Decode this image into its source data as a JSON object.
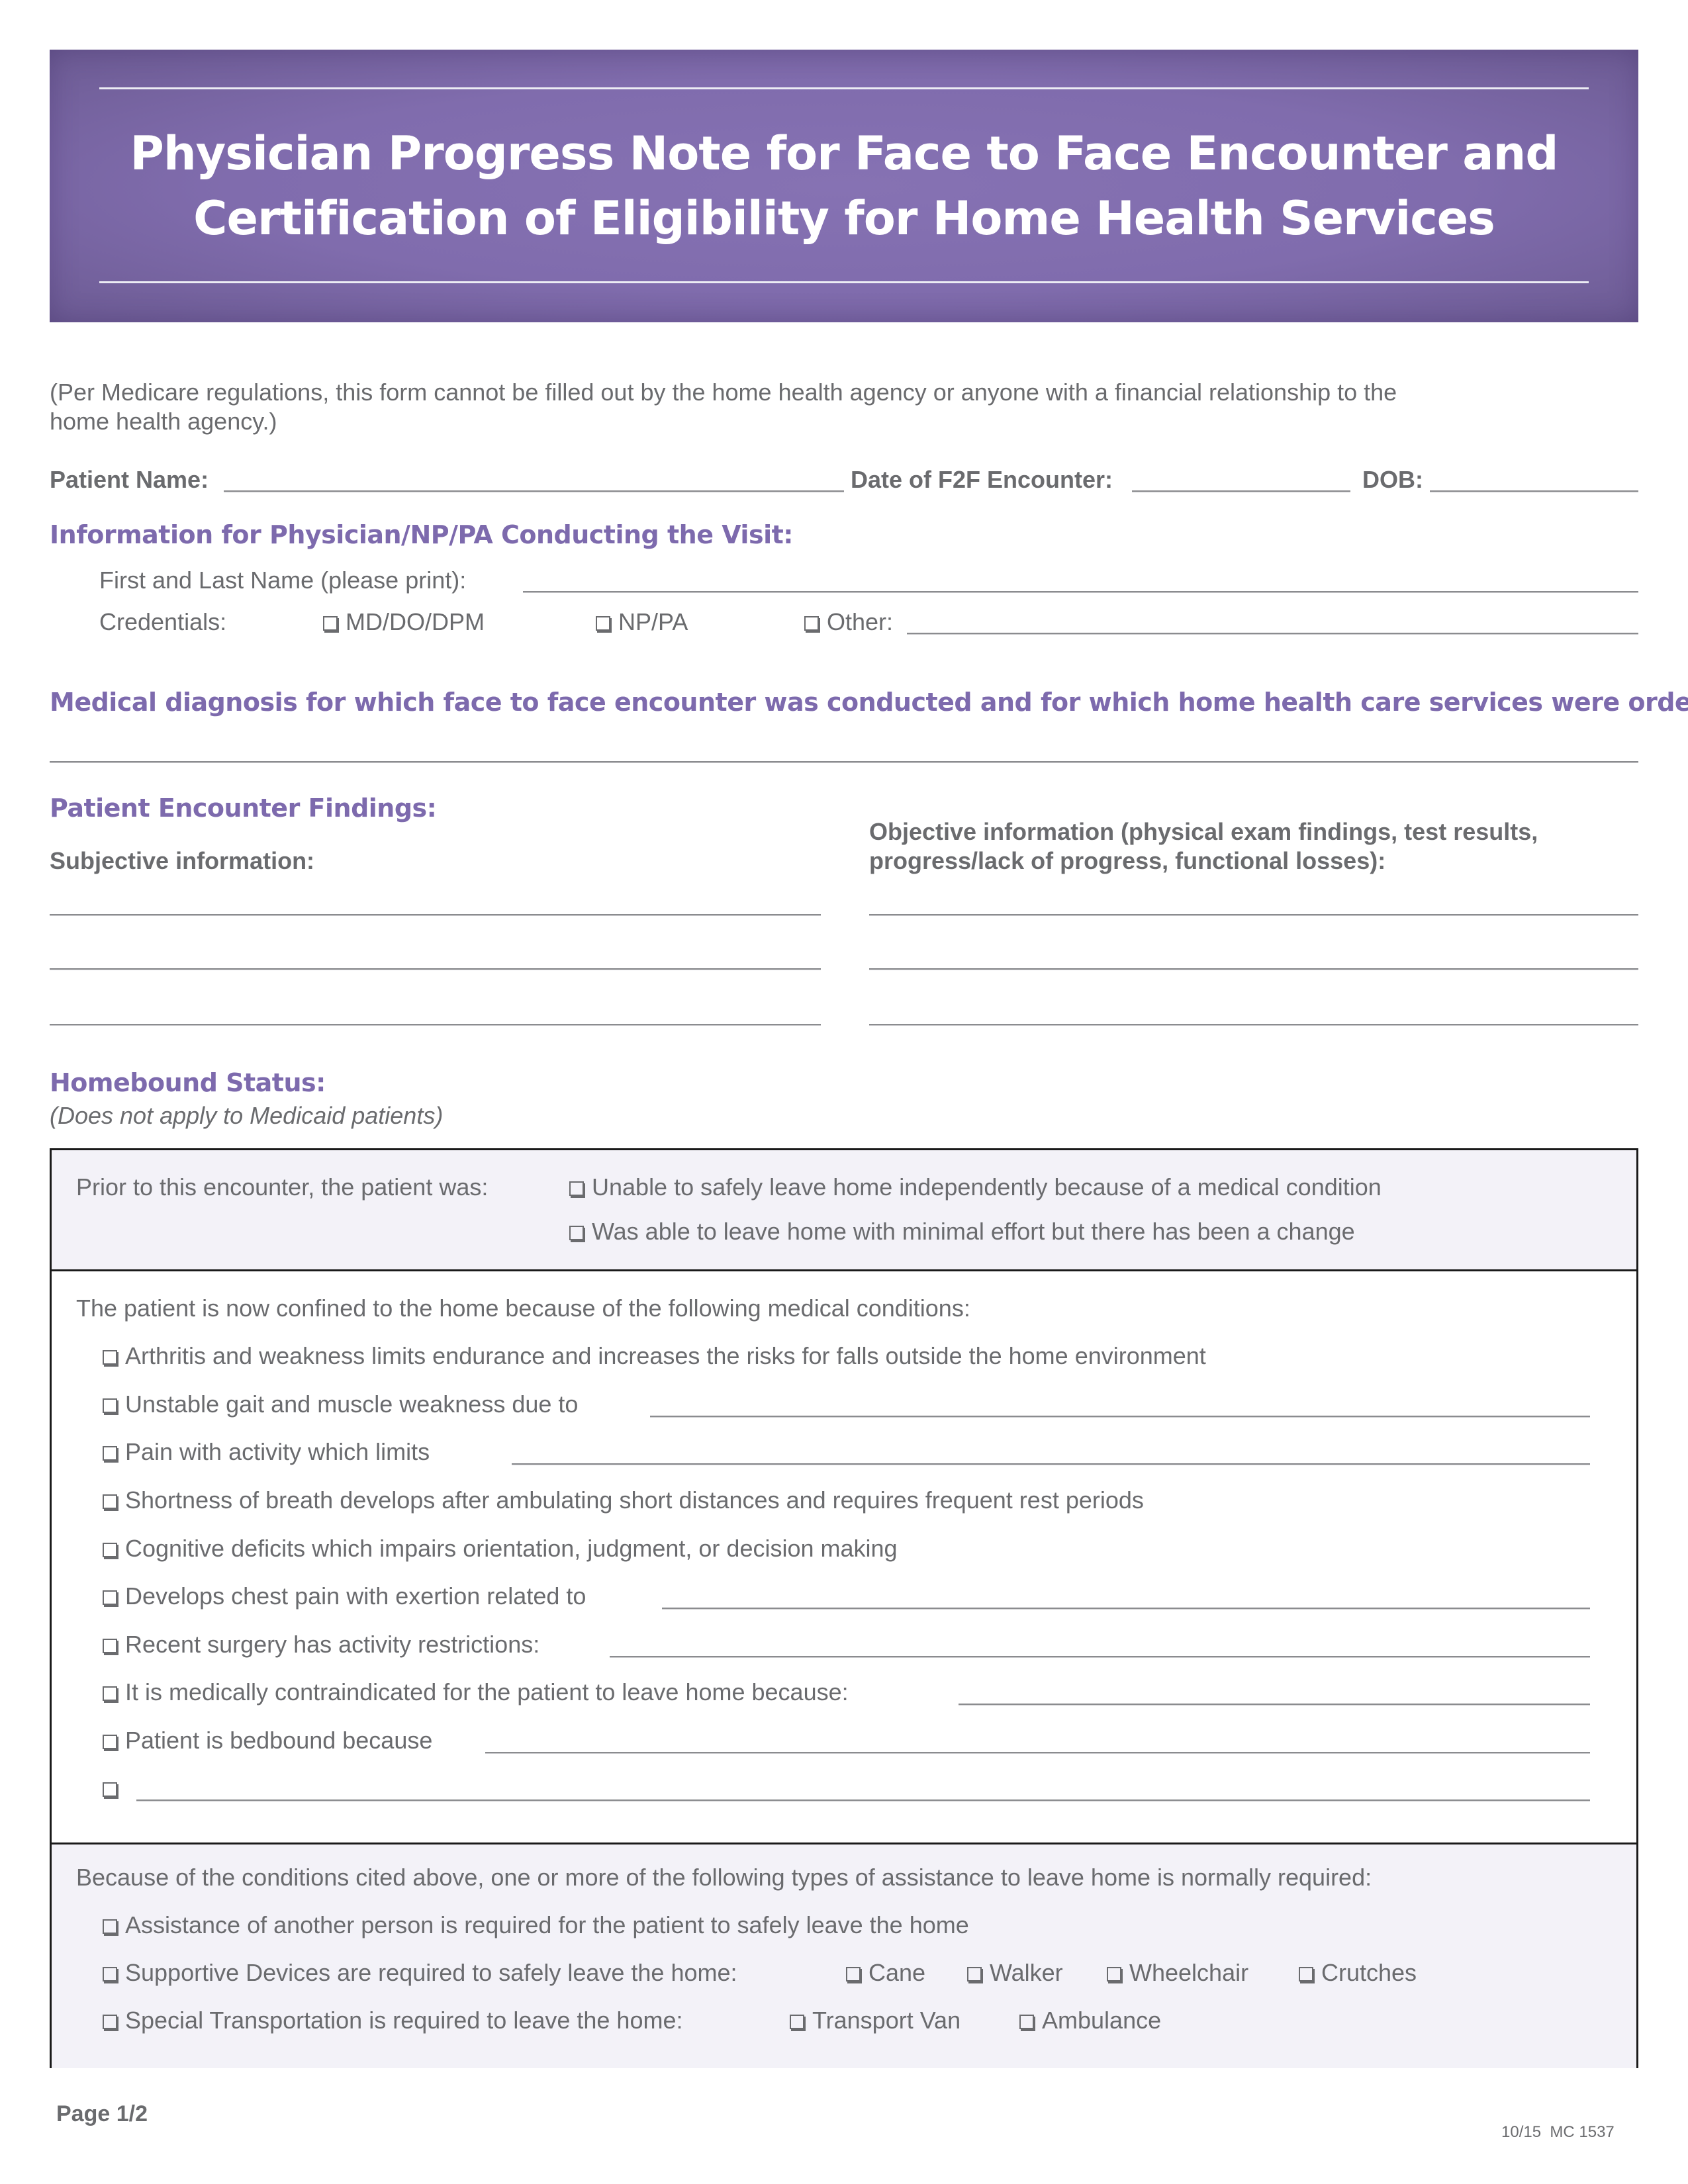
{
  "header": {
    "title_line1": "Physician Progress Note for Face to Face Encounter and",
    "title_line2": "Certification of Eligibility for Home Health Services"
  },
  "disclaimer": {
    "line1": "(Per Medicare regulations, this form cannot be filled out by the home health agency or anyone with a financial relationship to the",
    "line2": "home health agency.)"
  },
  "patient_fields": {
    "patient_name_label": "Patient Name:",
    "patient_name_value": "",
    "f2f_date_label": "Date of F2F Encounter:",
    "f2f_date_value": "",
    "dob_label": "DOB:",
    "dob_value": ""
  },
  "physician_info": {
    "heading": "Information for Physician/NP/PA Conducting the Visit:",
    "name_label": "First and Last Name (please print):",
    "name_value": "",
    "credentials_label": "Credentials:",
    "credentials": [
      {
        "label": "MD/DO/DPM",
        "checked": false
      },
      {
        "label": "NP/PA",
        "checked": false
      },
      {
        "label": "Other:",
        "checked": false
      }
    ],
    "other_value": ""
  },
  "diagnosis": {
    "heading": "Medical diagnosis for which face to face encounter was conducted and for which home health care services were ordered:",
    "value": ""
  },
  "findings": {
    "heading": "Patient Encounter Findings:",
    "subjective_label": "Subjective information:",
    "objective_label_line1": "Objective information (physical exam findings, test results,",
    "objective_label_line2": "progress/lack of progress, functional losses):",
    "subjective_lines": [
      "",
      "",
      ""
    ],
    "objective_lines": [
      "",
      "",
      ""
    ]
  },
  "homebound": {
    "heading": "Homebound Status:",
    "subheading": "(Does not apply to Medicaid patients)",
    "prior_label": "Prior to this encounter, the patient was:",
    "prior_options": [
      {
        "label": "Unable to safely leave home independently because of a medical condition",
        "checked": false
      },
      {
        "label": "Was able to leave home with minimal effort but there has been a change",
        "checked": false
      }
    ],
    "confined_label": "The patient is now confined to the home because of the following medical conditions:",
    "conditions": [
      {
        "label": "Arthritis and weakness limits endurance and increases the risks for falls outside the home environment",
        "has_blank": false,
        "checked": false
      },
      {
        "label": "Unstable gait and muscle weakness due to",
        "has_blank": true,
        "checked": false
      },
      {
        "label": "Pain with activity which limits",
        "has_blank": true,
        "checked": false
      },
      {
        "label": "Shortness of breath develops after ambulating short distances and requires frequent rest periods",
        "has_blank": false,
        "checked": false
      },
      {
        "label": "Cognitive deficits which impairs orientation, judgment, or decision making",
        "has_blank": false,
        "checked": false
      },
      {
        "label": "Develops chest pain with exertion related to",
        "has_blank": true,
        "checked": false
      },
      {
        "label": "Recent surgery has activity restrictions:",
        "has_blank": true,
        "checked": false
      },
      {
        "label": "It is medically contraindicated for the patient to leave home because:",
        "has_blank": true,
        "checked": false
      },
      {
        "label": "Patient is bedbound because",
        "has_blank": true,
        "checked": false
      },
      {
        "label": "",
        "has_blank": true,
        "checked": false
      }
    ],
    "assistance_label": "Because of the conditions cited above, one or more of the following types of assistance to leave home is normally required:",
    "assistance_person": "Assistance of another person is required for the patient to safely leave the home",
    "devices_label": "Supportive Devices are required to safely leave the home:",
    "devices": [
      "Cane",
      "Walker",
      "Wheelchair",
      "Crutches"
    ],
    "transport_label": "Special Transportation is required to leave the home:",
    "transport": [
      "Transport Van",
      "Ambulance"
    ]
  },
  "footer": {
    "page": "Page 1/2",
    "form_code": "10/15  MC 1537"
  }
}
